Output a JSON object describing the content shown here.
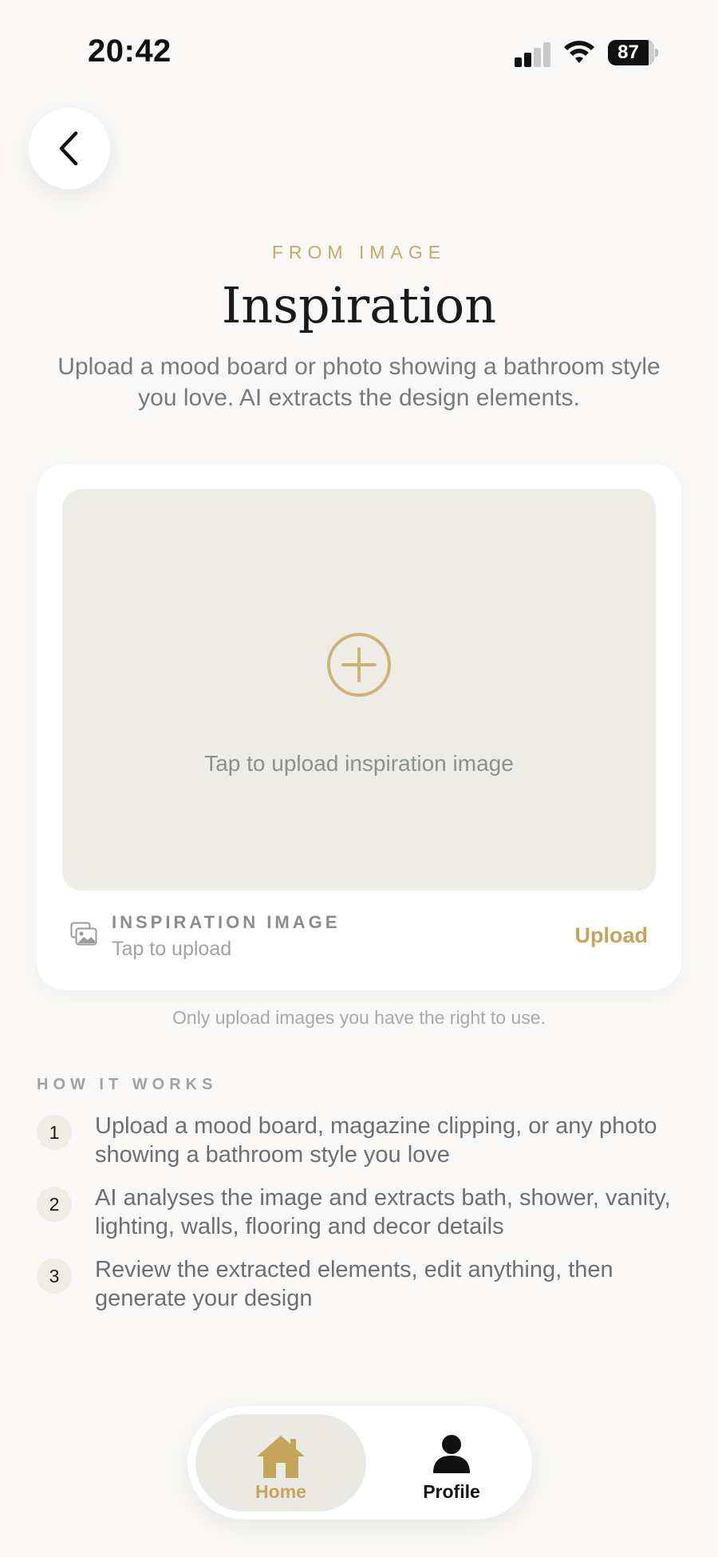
{
  "status_bar": {
    "time": "20:42",
    "battery": "87",
    "icons": [
      "signal-icon",
      "wifi-icon",
      "battery-icon"
    ]
  },
  "header": {
    "back_icon": "chevron-left-icon",
    "eyebrow": "FROM IMAGE",
    "title": "Inspiration",
    "subtitle": "Upload a mood board or photo showing a bathroom style you love. AI extracts the design elements."
  },
  "upload_card": {
    "plus_icon": "plus-circle-icon",
    "dropzone_text": "Tap to upload inspiration image",
    "footer_icon": "image-icon",
    "footer_label": "INSPIRATION IMAGE",
    "footer_sub": "Tap to upload",
    "upload_label": "Upload"
  },
  "disclaimer": "Only upload images you have the right to use.",
  "how_it_works": {
    "heading": "HOW IT WORKS",
    "steps": [
      {
        "number": "1",
        "text": "Upload a mood board, magazine clipping, or any photo showing a bathroom style you love"
      },
      {
        "number": "2",
        "text": "AI analyses the image and extracts bath, shower, vanity, lighting, walls, flooring and decor details"
      },
      {
        "number": "3",
        "text": "Review the extracted elements, edit anything, then generate your design"
      }
    ]
  },
  "tab_bar": {
    "tabs": [
      {
        "label": "Home",
        "icon": "home-icon",
        "active": true
      },
      {
        "label": "Profile",
        "icon": "person-icon",
        "active": false
      }
    ]
  },
  "colors": {
    "accent": "#c4aa62",
    "background": "#f9f8f6",
    "card": "#ffffff",
    "dropzone": "#edece7"
  }
}
